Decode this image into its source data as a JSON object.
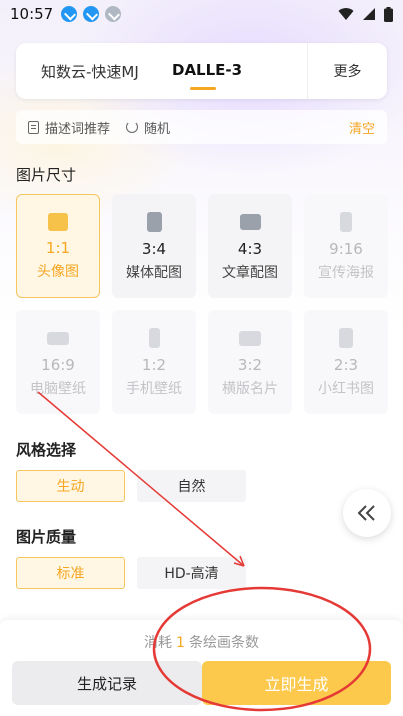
{
  "status": {
    "time": "10:57"
  },
  "models": {
    "tab1": "知数云-快速MJ",
    "tab2": "DALLE-3",
    "more": "更多"
  },
  "prompt_bar": {
    "recommend": "描述词推荐",
    "random": "随机",
    "clear": "清空"
  },
  "sections": {
    "size": "图片尺寸",
    "style": "风格选择",
    "quality": "图片质量"
  },
  "sizes": [
    {
      "ratio": "1:1",
      "label": "头像图"
    },
    {
      "ratio": "3:4",
      "label": "媒体配图"
    },
    {
      "ratio": "4:3",
      "label": "文章配图"
    },
    {
      "ratio": "9:16",
      "label": "宣传海报"
    },
    {
      "ratio": "16:9",
      "label": "电脑壁纸"
    },
    {
      "ratio": "1:2",
      "label": "手机壁纸"
    },
    {
      "ratio": "3:2",
      "label": "横版名片"
    },
    {
      "ratio": "2:3",
      "label": "小红书图"
    }
  ],
  "styles": [
    "生动",
    "自然"
  ],
  "qualities": [
    "标准",
    "HD-高清"
  ],
  "bottom": {
    "consume_prefix": "消耗",
    "consume_num": "1",
    "consume_suffix": "条绘画条数",
    "history": "生成记录",
    "generate": "立即生成"
  },
  "colors": {
    "accent": "#f5a623",
    "generate_bg": "#fcc94d",
    "annotation_red": "#e53935"
  }
}
